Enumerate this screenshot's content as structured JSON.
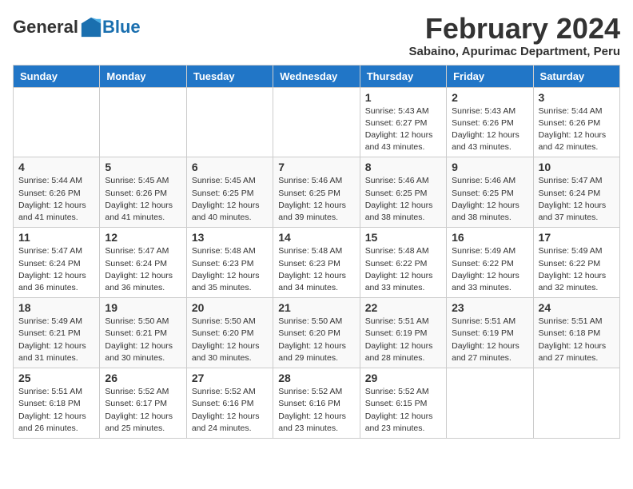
{
  "logo": {
    "general": "General",
    "blue": "Blue"
  },
  "title": "February 2024",
  "subtitle": "Sabaino, Apurimac Department, Peru",
  "days_of_week": [
    "Sunday",
    "Monday",
    "Tuesday",
    "Wednesday",
    "Thursday",
    "Friday",
    "Saturday"
  ],
  "weeks": [
    [
      {
        "day": "",
        "info": ""
      },
      {
        "day": "",
        "info": ""
      },
      {
        "day": "",
        "info": ""
      },
      {
        "day": "",
        "info": ""
      },
      {
        "day": "1",
        "info": "Sunrise: 5:43 AM\nSunset: 6:27 PM\nDaylight: 12 hours\nand 43 minutes."
      },
      {
        "day": "2",
        "info": "Sunrise: 5:43 AM\nSunset: 6:26 PM\nDaylight: 12 hours\nand 43 minutes."
      },
      {
        "day": "3",
        "info": "Sunrise: 5:44 AM\nSunset: 6:26 PM\nDaylight: 12 hours\nand 42 minutes."
      }
    ],
    [
      {
        "day": "4",
        "info": "Sunrise: 5:44 AM\nSunset: 6:26 PM\nDaylight: 12 hours\nand 41 minutes."
      },
      {
        "day": "5",
        "info": "Sunrise: 5:45 AM\nSunset: 6:26 PM\nDaylight: 12 hours\nand 41 minutes."
      },
      {
        "day": "6",
        "info": "Sunrise: 5:45 AM\nSunset: 6:25 PM\nDaylight: 12 hours\nand 40 minutes."
      },
      {
        "day": "7",
        "info": "Sunrise: 5:46 AM\nSunset: 6:25 PM\nDaylight: 12 hours\nand 39 minutes."
      },
      {
        "day": "8",
        "info": "Sunrise: 5:46 AM\nSunset: 6:25 PM\nDaylight: 12 hours\nand 38 minutes."
      },
      {
        "day": "9",
        "info": "Sunrise: 5:46 AM\nSunset: 6:25 PM\nDaylight: 12 hours\nand 38 minutes."
      },
      {
        "day": "10",
        "info": "Sunrise: 5:47 AM\nSunset: 6:24 PM\nDaylight: 12 hours\nand 37 minutes."
      }
    ],
    [
      {
        "day": "11",
        "info": "Sunrise: 5:47 AM\nSunset: 6:24 PM\nDaylight: 12 hours\nand 36 minutes."
      },
      {
        "day": "12",
        "info": "Sunrise: 5:47 AM\nSunset: 6:24 PM\nDaylight: 12 hours\nand 36 minutes."
      },
      {
        "day": "13",
        "info": "Sunrise: 5:48 AM\nSunset: 6:23 PM\nDaylight: 12 hours\nand 35 minutes."
      },
      {
        "day": "14",
        "info": "Sunrise: 5:48 AM\nSunset: 6:23 PM\nDaylight: 12 hours\nand 34 minutes."
      },
      {
        "day": "15",
        "info": "Sunrise: 5:48 AM\nSunset: 6:22 PM\nDaylight: 12 hours\nand 33 minutes."
      },
      {
        "day": "16",
        "info": "Sunrise: 5:49 AM\nSunset: 6:22 PM\nDaylight: 12 hours\nand 33 minutes."
      },
      {
        "day": "17",
        "info": "Sunrise: 5:49 AM\nSunset: 6:22 PM\nDaylight: 12 hours\nand 32 minutes."
      }
    ],
    [
      {
        "day": "18",
        "info": "Sunrise: 5:49 AM\nSunset: 6:21 PM\nDaylight: 12 hours\nand 31 minutes."
      },
      {
        "day": "19",
        "info": "Sunrise: 5:50 AM\nSunset: 6:21 PM\nDaylight: 12 hours\nand 30 minutes."
      },
      {
        "day": "20",
        "info": "Sunrise: 5:50 AM\nSunset: 6:20 PM\nDaylight: 12 hours\nand 30 minutes."
      },
      {
        "day": "21",
        "info": "Sunrise: 5:50 AM\nSunset: 6:20 PM\nDaylight: 12 hours\nand 29 minutes."
      },
      {
        "day": "22",
        "info": "Sunrise: 5:51 AM\nSunset: 6:19 PM\nDaylight: 12 hours\nand 28 minutes."
      },
      {
        "day": "23",
        "info": "Sunrise: 5:51 AM\nSunset: 6:19 PM\nDaylight: 12 hours\nand 27 minutes."
      },
      {
        "day": "24",
        "info": "Sunrise: 5:51 AM\nSunset: 6:18 PM\nDaylight: 12 hours\nand 27 minutes."
      }
    ],
    [
      {
        "day": "25",
        "info": "Sunrise: 5:51 AM\nSunset: 6:18 PM\nDaylight: 12 hours\nand 26 minutes."
      },
      {
        "day": "26",
        "info": "Sunrise: 5:52 AM\nSunset: 6:17 PM\nDaylight: 12 hours\nand 25 minutes."
      },
      {
        "day": "27",
        "info": "Sunrise: 5:52 AM\nSunset: 6:16 PM\nDaylight: 12 hours\nand 24 minutes."
      },
      {
        "day": "28",
        "info": "Sunrise: 5:52 AM\nSunset: 6:16 PM\nDaylight: 12 hours\nand 23 minutes."
      },
      {
        "day": "29",
        "info": "Sunrise: 5:52 AM\nSunset: 6:15 PM\nDaylight: 12 hours\nand 23 minutes."
      },
      {
        "day": "",
        "info": ""
      },
      {
        "day": "",
        "info": ""
      }
    ]
  ]
}
